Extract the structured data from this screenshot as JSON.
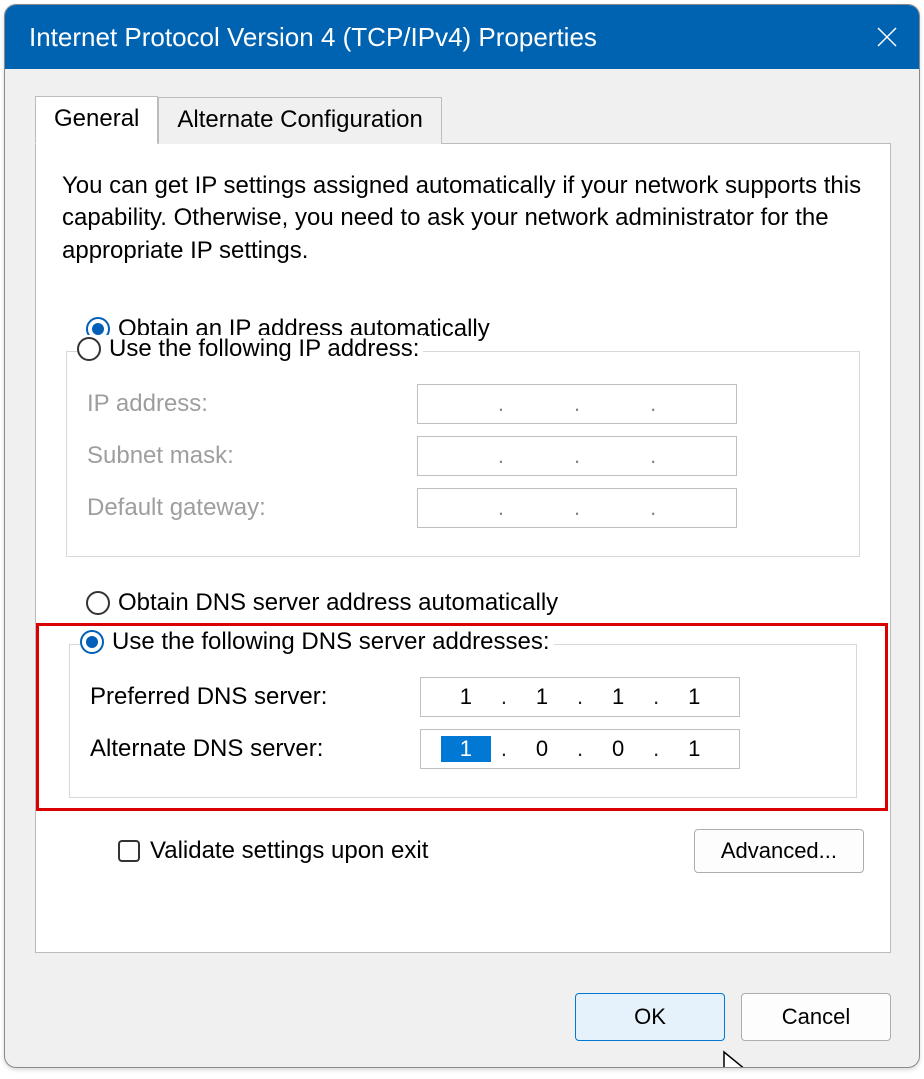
{
  "window": {
    "title": "Internet Protocol Version 4 (TCP/IPv4) Properties"
  },
  "tabs": {
    "general": "General",
    "alternate": "Alternate Configuration"
  },
  "intro": "You can get IP settings assigned automatically if your network supports this capability. Otherwise, you need to ask your network administrator for the appropriate IP settings.",
  "ip": {
    "auto": "Obtain an IP address automatically",
    "manual": "Use the following IP address:",
    "address_label": "IP address:",
    "mask_label": "Subnet mask:",
    "gateway_label": "Default gateway:"
  },
  "dns": {
    "auto": "Obtain DNS server address automatically",
    "manual": "Use the following DNS server addresses:",
    "preferred_label": "Preferred DNS server:",
    "alternate_label": "Alternate DNS server:",
    "preferred": {
      "o1": "1",
      "o2": "1",
      "o3": "1",
      "o4": "1"
    },
    "alternate": {
      "o1": "1",
      "o2": "0",
      "o3": "0",
      "o4": "1"
    }
  },
  "validate": "Validate settings upon exit",
  "buttons": {
    "advanced": "Advanced...",
    "ok": "OK",
    "cancel": "Cancel"
  },
  "punct": {
    "dot": "."
  }
}
